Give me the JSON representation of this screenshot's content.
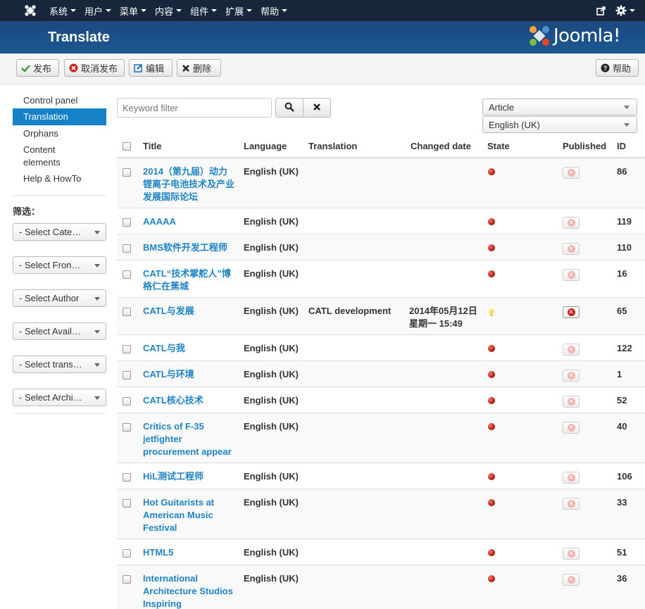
{
  "topnav": {
    "menu": [
      "系统",
      "用户",
      "菜单",
      "内容",
      "组件",
      "扩展",
      "帮助"
    ]
  },
  "header": {
    "title": "Translate",
    "brand": "Joomla!"
  },
  "toolbar": {
    "publish": "发布",
    "unpublish": "取消发布",
    "edit": "编辑",
    "delete": "删除",
    "help": "帮助"
  },
  "sidebar": {
    "items": [
      "Control panel",
      "Translation",
      "Orphans",
      "Content elements",
      "Help & HowTo"
    ],
    "filter_label": "筛选：",
    "selects": [
      "- Select Cate…",
      "- Select Fron…",
      "- Select Author",
      "- Select Avail…",
      "- Select trans…",
      "- Select Archi…"
    ]
  },
  "filter": {
    "keyword_placeholder": "Keyword filter",
    "content_type": "Article",
    "language": "English (UK)"
  },
  "table": {
    "headers": {
      "title": "Title",
      "language": "Language",
      "translation": "Translation",
      "changed": "Changed date",
      "state": "State",
      "published": "Published",
      "id": "ID"
    },
    "rows": [
      {
        "title": "2014（第九届）动力锂离子电池技术及产业发展国际论坛",
        "language": "English (UK)",
        "translation": "",
        "changed": "",
        "state": "unpublished",
        "published": false,
        "id": "86"
      },
      {
        "title": "AAAAA",
        "language": "English (UK)",
        "translation": "",
        "changed": "",
        "state": "unpublished",
        "published": false,
        "id": "119"
      },
      {
        "title": "BMS软件开发工程师",
        "language": "English (UK)",
        "translation": "",
        "changed": "",
        "state": "unpublished",
        "published": false,
        "id": "110"
      },
      {
        "title": "CATL“技术掌舵人”博格仁在蕉城",
        "language": "English (UK)",
        "translation": "",
        "changed": "",
        "state": "unpublished",
        "published": false,
        "id": "16"
      },
      {
        "title": "CATL与发展",
        "language": "English (UK)",
        "translation": "CATL development",
        "changed": "2014年05月12日 星期一 15:49",
        "state": "translated",
        "published": true,
        "id": "65"
      },
      {
        "title": "CATL与我",
        "language": "English (UK)",
        "translation": "",
        "changed": "",
        "state": "unpublished",
        "published": false,
        "id": "122"
      },
      {
        "title": "CATL与环境",
        "language": "English (UK)",
        "translation": "",
        "changed": "",
        "state": "unpublished",
        "published": false,
        "id": "1"
      },
      {
        "title": "CATL核心技术",
        "language": "English (UK)",
        "translation": "",
        "changed": "",
        "state": "unpublished",
        "published": false,
        "id": "52"
      },
      {
        "title": "Critics of F-35 jetfighter procurement appear",
        "language": "English (UK)",
        "translation": "",
        "changed": "",
        "state": "unpublished",
        "published": false,
        "id": "40"
      },
      {
        "title": "HiL测试工程师",
        "language": "English (UK)",
        "translation": "",
        "changed": "",
        "state": "unpublished",
        "published": false,
        "id": "106"
      },
      {
        "title": "Hot Guitarists at American Music Festival",
        "language": "English (UK)",
        "translation": "",
        "changed": "",
        "state": "unpublished",
        "published": false,
        "id": "33"
      },
      {
        "title": "HTML5",
        "language": "English (UK)",
        "translation": "",
        "changed": "",
        "state": "unpublished",
        "published": false,
        "id": "51"
      },
      {
        "title": "International Architecture Studios Inspiring",
        "language": "English (UK)",
        "translation": "",
        "changed": "",
        "state": "unpublished",
        "published": false,
        "id": "36"
      }
    ]
  }
}
